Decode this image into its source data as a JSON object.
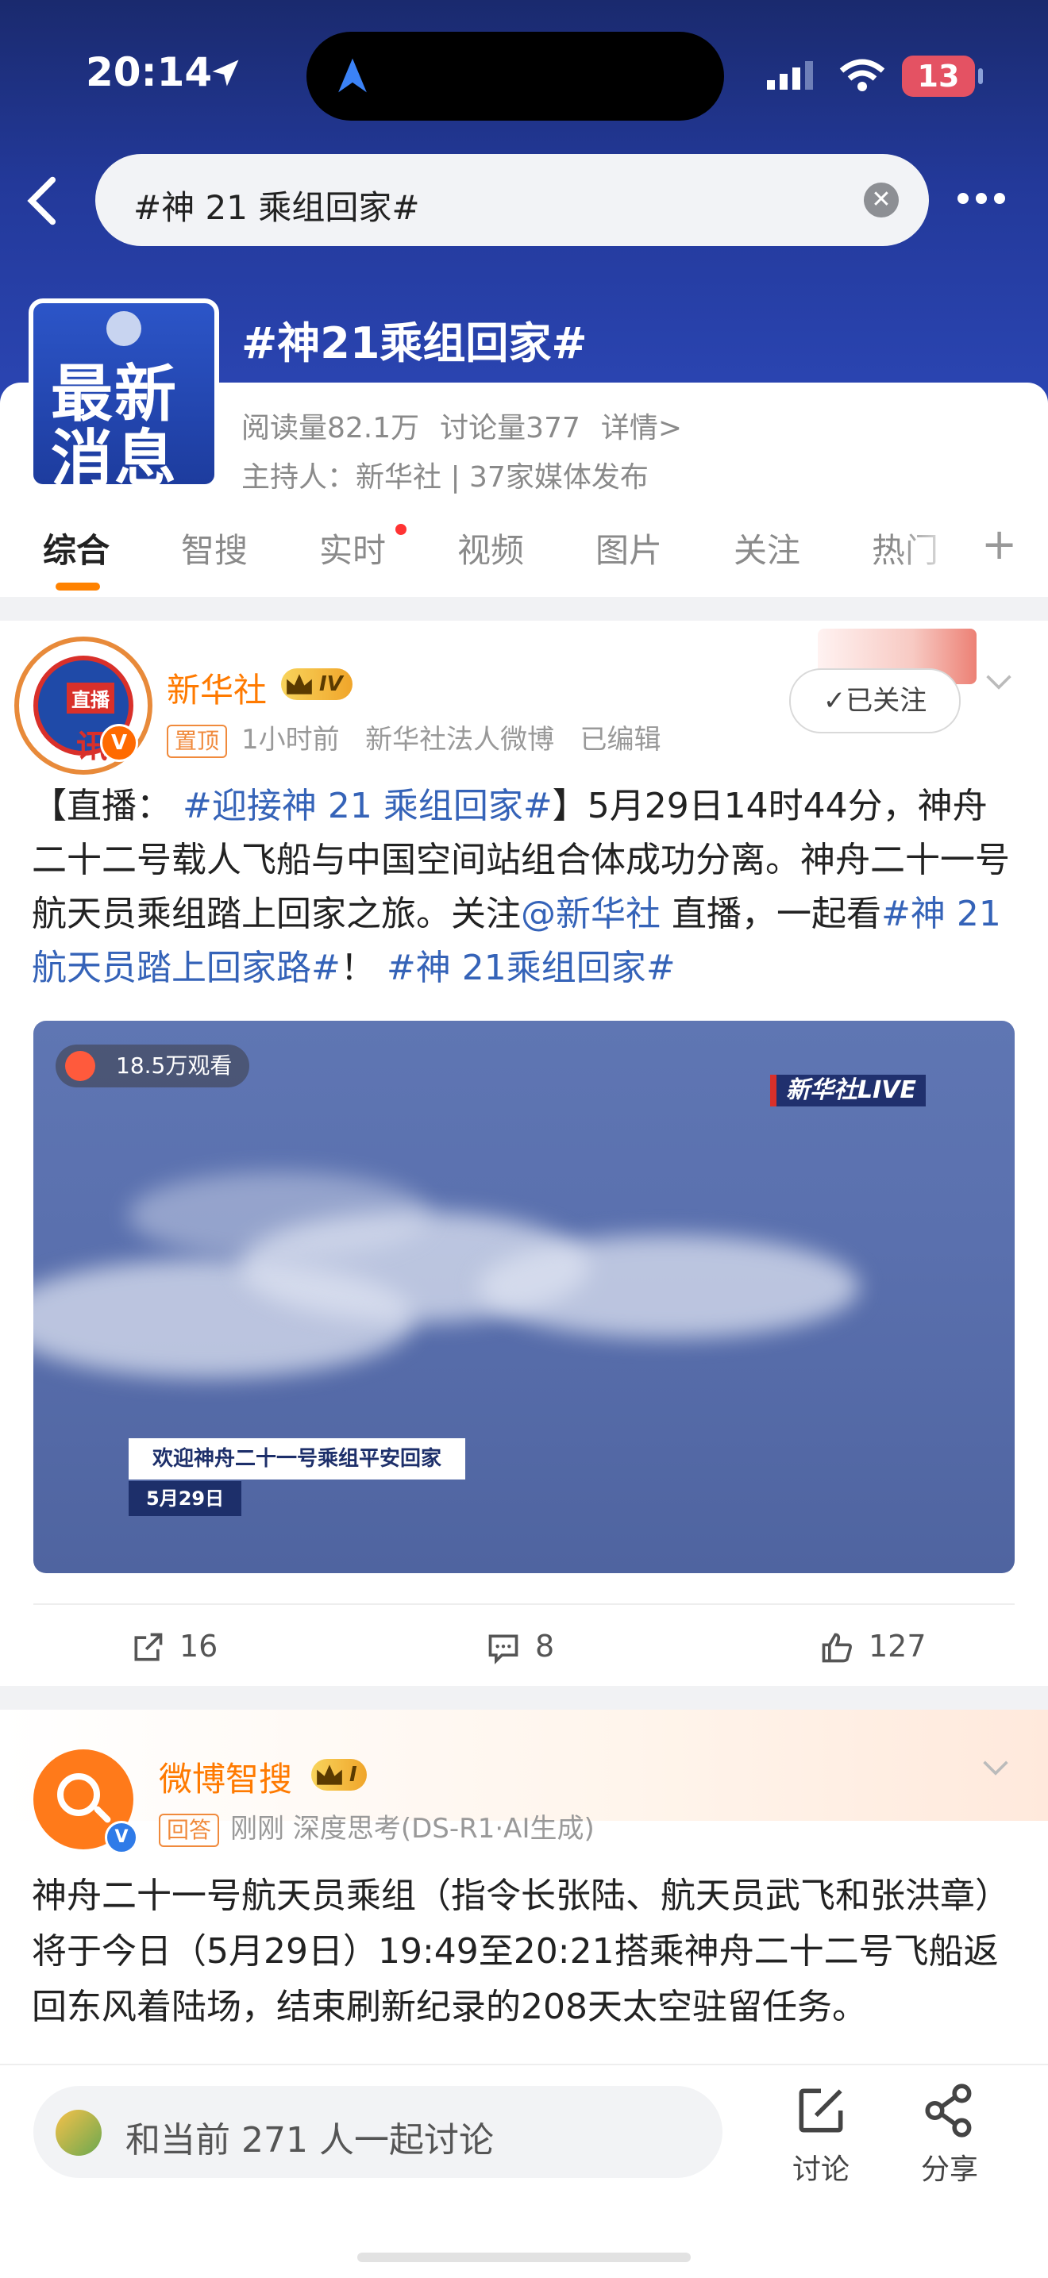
{
  "status_bar": {
    "time": "20:14",
    "battery": "13"
  },
  "search": {
    "query": "#神 21 乘组回家#"
  },
  "topic": {
    "thumb_line1": "最新",
    "thumb_line2": "消息",
    "title": "#神21乘组回家#",
    "reads": "阅读量82.1万",
    "discussions": "讨论量377",
    "details": "详情>",
    "host": "主持人：新华社 | 37家媒体发布"
  },
  "tabs": [
    "综合",
    "智搜",
    "实时",
    "视频",
    "图片",
    "关注",
    "热门"
  ],
  "post1": {
    "avatar_top": "直播",
    "avatar_mid": "讯",
    "author": "新华社",
    "level": "IV",
    "pin": "置顶",
    "time": "1小时前",
    "source": "新华社法人微博",
    "edited": "已编辑",
    "follow": "✓已关注",
    "text_1": "【直播：",
    "tag_1": "#迎接神 21 乘组回家#",
    "text_2": "】5月29日14时44分，神舟二十二号载人飞船与中国空间站组合体成功分离。神舟二十一号航天员乘组踏上回家之旅。关注",
    "mention": "@新华社",
    "text_3": "直播，一起看",
    "tag_2": "#神 21航天员踏上回家路#",
    "text_4": "！",
    "tag_3": "#神 21乘组回家#",
    "media": {
      "viewers": "18.5万观看",
      "live_tag": "新华社LIVE",
      "caption": "欢迎神舟二十一号乘组平安回家",
      "date": "5月29日"
    },
    "shares": "16",
    "comments": "8",
    "likes": "127"
  },
  "post2": {
    "author": "微博智搜",
    "level": "I",
    "tag": "回答",
    "time": "刚刚",
    "source": "深度思考(DS-R1·AI生成)",
    "text": "神舟二十一号航天员乘组（指令长张陆、航天员武飞和张洪章）将于今日（5月29日）19:49至20:21搭乘神舟二十二号飞船返回东风着陆场，结束刷新纪录的208天太空驻留任务。"
  },
  "bottom": {
    "discuss_placeholder": "和当前 271 人一起讨论",
    "discuss_btn": "讨论",
    "share_btn": "分享"
  },
  "colors": {
    "brand_orange": "#ff8200",
    "link_blue": "#3563b8",
    "hero_blue": "#23399a"
  }
}
